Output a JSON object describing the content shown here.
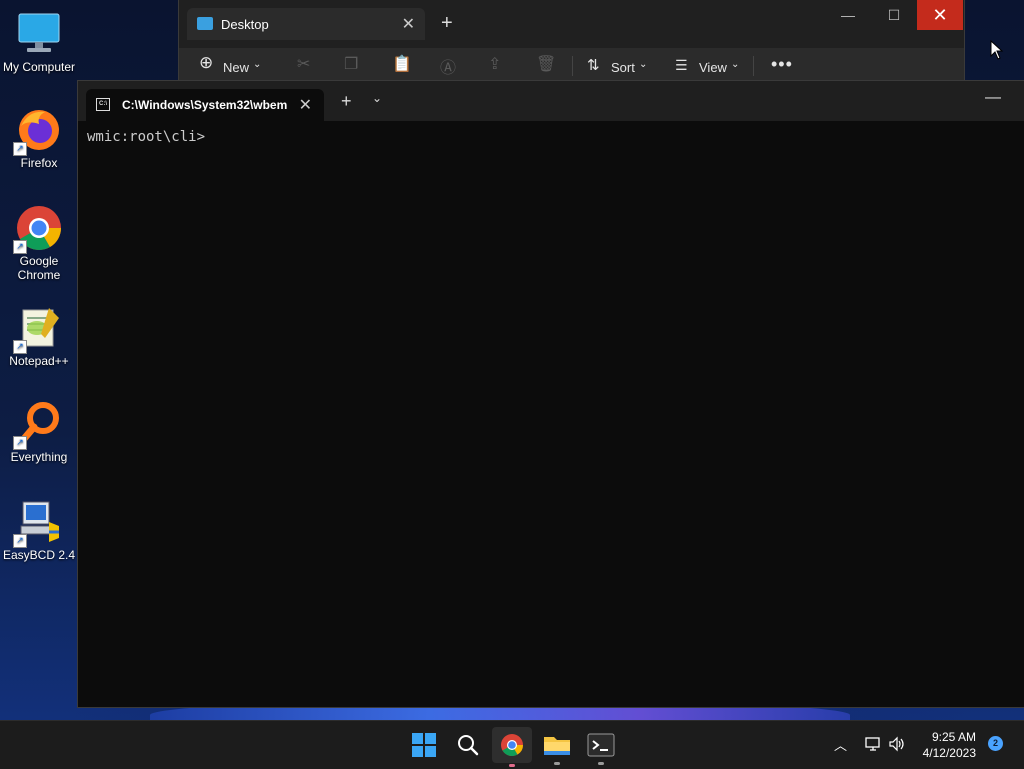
{
  "desktop": {
    "icons": [
      {
        "label": "My Computer"
      },
      {
        "label": "Firefox"
      },
      {
        "label": "Google Chrome"
      },
      {
        "label": "Notepad++"
      },
      {
        "label": "Everything"
      },
      {
        "label": "EasyBCD 2.4"
      }
    ]
  },
  "explorer": {
    "tab_title": "Desktop",
    "toolbar": {
      "new_label": "New",
      "sort_label": "Sort",
      "view_label": "View"
    }
  },
  "terminal": {
    "tab_title": "C:\\Windows\\System32\\wbem",
    "prompt": "wmic:root\\cli>"
  },
  "taskbar": {
    "time": "9:25 AM",
    "date": "4/12/2023",
    "notification_count": "2"
  },
  "colors": {
    "close_red": "#c42b1c",
    "accent_blue": "#4aa3ff"
  }
}
